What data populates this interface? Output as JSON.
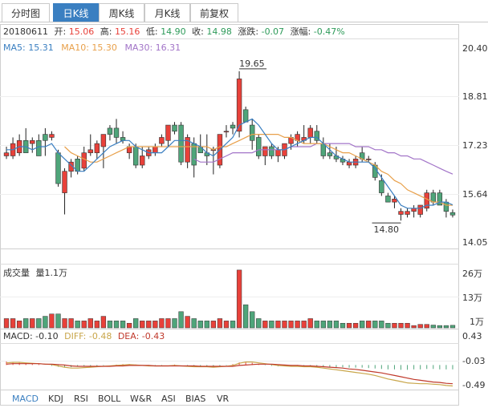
{
  "tabs": [
    {
      "label": "分时图",
      "active": false
    },
    {
      "label": "日K线",
      "active": true
    },
    {
      "label": "周K线",
      "active": false
    },
    {
      "label": "月K线",
      "active": false
    },
    {
      "label": "前复权",
      "active": false
    }
  ],
  "info_bar": {
    "date": "20180611",
    "open_label": "开:",
    "open": "15.06",
    "high_label": "高:",
    "high": "15.16",
    "low_label": "低:",
    "low": "14.90",
    "close_label": "收:",
    "close": "14.98",
    "change_label": "涨跌:",
    "change": "-0.07",
    "pct_label": "涨幅:",
    "pct": "-0.47%"
  },
  "ma_bar": {
    "ma5": "MA5: 15.31",
    "ma10": "MA10: 15.30",
    "ma30": "MA30: 16.31"
  },
  "volume_bar": {
    "title": "成交量",
    "value": "量1.1万"
  },
  "macd_bar": {
    "macd": "MACD: -0.10",
    "diff": "DIFF: -0.48",
    "dea": "DEA: -0.43"
  },
  "indicator_tabs": [
    {
      "label": "MACD",
      "active": true
    },
    {
      "label": "KDJ",
      "active": false
    },
    {
      "label": "RSI",
      "active": false
    },
    {
      "label": "BOLL",
      "active": false
    },
    {
      "label": "W&R",
      "active": false
    },
    {
      "label": "ASI",
      "active": false
    },
    {
      "label": "BIAS",
      "active": false
    },
    {
      "label": "VR",
      "active": false
    }
  ],
  "colors": {
    "up": "#e8413a",
    "down": "#4fa57a",
    "ma5": "#3a7fc1",
    "ma10": "#e8a04a",
    "ma30": "#a274c8",
    "diff": "#c9a64a",
    "dea": "#c0392b",
    "tab_active": "#3a7fc1",
    "grid": "#dcdcdc",
    "down_text": "#2e9b5a"
  },
  "chart_data": [
    {
      "type": "candlestick",
      "title": "",
      "ylim": [
        14.05,
        20.4
      ],
      "y_ticks": [
        "20.40",
        "18.81",
        "17.23",
        "15.64",
        "14.05"
      ],
      "annotations": [
        {
          "label": "19.65",
          "kind": "high"
        },
        {
          "label": "14.80",
          "kind": "low"
        }
      ],
      "candles": [
        [
          16.9,
          17.2,
          16.8,
          17.0
        ],
        [
          16.9,
          17.5,
          16.8,
          17.3
        ],
        [
          17.0,
          17.6,
          16.9,
          17.4
        ],
        [
          17.4,
          17.8,
          17.0,
          17.0
        ],
        [
          17.3,
          17.5,
          17.0,
          17.4
        ],
        [
          17.4,
          17.6,
          16.9,
          16.9
        ],
        [
          17.6,
          17.8,
          16.9,
          17.4
        ],
        [
          17.5,
          17.7,
          17.4,
          17.6
        ],
        [
          17.0,
          17.1,
          15.9,
          16.0
        ],
        [
          15.7,
          16.5,
          15.0,
          16.4
        ],
        [
          16.4,
          16.8,
          16.2,
          16.7
        ],
        [
          16.8,
          16.9,
          16.3,
          16.4
        ],
        [
          16.5,
          17.2,
          16.4,
          17.0
        ],
        [
          17.0,
          17.6,
          16.9,
          17.1
        ],
        [
          17.0,
          17.4,
          16.8,
          17.3
        ],
        [
          17.2,
          17.6,
          16.5,
          17.6
        ],
        [
          17.8,
          17.9,
          17.4,
          17.6
        ],
        [
          17.8,
          18.1,
          17.3,
          17.5
        ],
        [
          17.5,
          17.7,
          17.3,
          17.4
        ],
        [
          17.0,
          17.3,
          16.8,
          17.2
        ],
        [
          17.2,
          17.3,
          16.5,
          16.6
        ],
        [
          16.6,
          17.2,
          16.5,
          16.9
        ],
        [
          16.9,
          17.2,
          16.8,
          17.1
        ],
        [
          17.0,
          17.3,
          16.9,
          17.2
        ],
        [
          17.3,
          17.6,
          17.2,
          17.5
        ],
        [
          17.4,
          17.9,
          17.2,
          17.9
        ],
        [
          17.9,
          18.0,
          17.6,
          17.7
        ],
        [
          17.9,
          18.0,
          16.6,
          16.7
        ],
        [
          16.7,
          17.6,
          16.5,
          17.5
        ],
        [
          17.3,
          17.5,
          16.2,
          16.6
        ],
        [
          17.2,
          17.6,
          17.0,
          17.0
        ],
        [
          17.0,
          17.6,
          16.6,
          16.9
        ],
        [
          17.1,
          17.2,
          16.3,
          17.1
        ],
        [
          16.6,
          17.6,
          16.5,
          17.6
        ],
        [
          17.7,
          17.9,
          17.5,
          17.7
        ],
        [
          17.9,
          18.0,
          17.6,
          17.8
        ],
        [
          17.7,
          19.65,
          17.5,
          19.4
        ],
        [
          18.4,
          18.5,
          18.0,
          18.0
        ],
        [
          17.9,
          18.1,
          17.1,
          17.4
        ],
        [
          17.5,
          17.6,
          16.8,
          16.9
        ],
        [
          16.9,
          17.2,
          16.6,
          17.2
        ],
        [
          17.2,
          17.3,
          16.8,
          16.9
        ],
        [
          16.9,
          17.2,
          16.7,
          17.1
        ],
        [
          16.9,
          17.3,
          16.8,
          17.3
        ],
        [
          17.3,
          17.6,
          17.1,
          17.5
        ],
        [
          17.4,
          17.7,
          17.2,
          17.6
        ],
        [
          17.4,
          17.9,
          17.3,
          17.5
        ],
        [
          17.5,
          17.9,
          17.3,
          17.8
        ],
        [
          17.7,
          17.9,
          17.3,
          17.4
        ],
        [
          17.3,
          17.5,
          16.8,
          16.9
        ],
        [
          17.0,
          17.3,
          16.8,
          16.9
        ],
        [
          16.9,
          17.2,
          16.7,
          16.8
        ],
        [
          16.8,
          16.9,
          16.6,
          16.7
        ],
        [
          16.6,
          16.8,
          16.5,
          16.7
        ],
        [
          16.6,
          16.9,
          16.5,
          16.8
        ],
        [
          17.0,
          17.2,
          16.7,
          16.8
        ],
        [
          16.8,
          16.9,
          16.7,
          16.8
        ],
        [
          16.6,
          16.7,
          16.1,
          16.2
        ],
        [
          16.1,
          16.3,
          15.6,
          15.7
        ],
        [
          15.6,
          15.7,
          15.4,
          15.4
        ],
        [
          15.4,
          15.6,
          15.2,
          15.5
        ],
        [
          15.0,
          15.2,
          14.8,
          15.1
        ],
        [
          15.0,
          15.2,
          14.9,
          15.1
        ],
        [
          15.1,
          15.3,
          14.9,
          15.2
        ],
        [
          15.0,
          15.3,
          14.9,
          15.3
        ],
        [
          15.2,
          15.8,
          15.1,
          15.7
        ],
        [
          15.7,
          15.8,
          15.3,
          15.4
        ],
        [
          15.7,
          15.8,
          15.3,
          15.3
        ],
        [
          15.4,
          15.5,
          14.9,
          15.1
        ],
        [
          15.06,
          15.16,
          14.9,
          14.98
        ]
      ],
      "ma5": [
        17.1,
        17.1,
        17.2,
        17.2,
        17.1,
        17.2,
        17.2,
        17.3,
        17.0,
        16.8,
        16.6,
        16.4,
        16.4,
        16.6,
        16.8,
        17.0,
        17.2,
        17.3,
        17.4,
        17.4,
        17.2,
        17.1,
        17.0,
        17.0,
        17.0,
        17.2,
        17.4,
        17.4,
        17.4,
        17.3,
        17.2,
        17.0,
        16.9,
        17.1,
        17.3,
        17.5,
        17.9,
        18.0,
        18.1,
        17.9,
        17.6,
        17.3,
        17.1,
        17.1,
        17.2,
        17.3,
        17.4,
        17.5,
        17.5,
        17.3,
        17.1,
        16.9,
        16.8,
        16.7,
        16.7,
        16.7,
        16.7,
        16.5,
        16.2,
        15.9,
        15.6,
        15.3,
        15.2,
        15.2,
        15.2,
        15.3,
        15.3,
        15.4,
        15.4,
        15.31
      ],
      "ma10": [
        null,
        null,
        null,
        null,
        null,
        null,
        null,
        null,
        null,
        17.2,
        17.0,
        16.9,
        16.8,
        16.7,
        16.7,
        16.8,
        16.9,
        17.0,
        17.1,
        17.2,
        17.2,
        17.2,
        17.2,
        17.2,
        17.2,
        17.2,
        17.2,
        17.2,
        17.2,
        17.2,
        17.2,
        17.2,
        17.1,
        17.2,
        17.2,
        17.3,
        17.4,
        17.5,
        17.6,
        17.6,
        17.6,
        17.6,
        17.6,
        17.5,
        17.5,
        17.4,
        17.3,
        17.3,
        17.3,
        17.3,
        17.2,
        17.1,
        17.0,
        17.0,
        16.9,
        16.8,
        16.7,
        16.6,
        16.4,
        16.3,
        16.1,
        16.0,
        15.8,
        15.7,
        15.6,
        15.5,
        15.4,
        15.4,
        15.3,
        15.3
      ],
      "ma30": [
        null,
        null,
        null,
        null,
        null,
        null,
        null,
        null,
        null,
        null,
        null,
        null,
        null,
        null,
        null,
        null,
        null,
        null,
        null,
        null,
        null,
        null,
        null,
        null,
        null,
        null,
        null,
        null,
        null,
        16.8,
        16.7,
        16.7,
        16.7,
        16.8,
        16.9,
        17.0,
        17.0,
        17.0,
        17.0,
        17.1,
        17.1,
        17.1,
        17.1,
        17.1,
        17.2,
        17.2,
        17.2,
        17.2,
        17.3,
        17.3,
        17.3,
        17.3,
        17.3,
        17.3,
        17.2,
        17.2,
        17.2,
        17.1,
        17.1,
        17.0,
        17.0,
        16.9,
        16.9,
        16.8,
        16.8,
        16.7,
        16.6,
        16.5,
        16.4,
        16.31
      ]
    },
    {
      "type": "bar",
      "title": "成交量",
      "ylim": [
        0,
        26
      ],
      "y_ticks": [
        "26万",
        "13万",
        "1万"
      ],
      "values": [
        4,
        4,
        3,
        4,
        4,
        4,
        5,
        6,
        6,
        4,
        4,
        3,
        3,
        4,
        3,
        5,
        3,
        3,
        3,
        2,
        4,
        3,
        3,
        3,
        4,
        4,
        4,
        7,
        5,
        4,
        3,
        3,
        3,
        4,
        3,
        3,
        25,
        10,
        7,
        4,
        3,
        3,
        3,
        3,
        3,
        3,
        3,
        4,
        3,
        3,
        3,
        3,
        2,
        2,
        2,
        3,
        3,
        3,
        3,
        2,
        2,
        2,
        2,
        1,
        1.5,
        1.5,
        1.2,
        1,
        1,
        1.1
      ]
    },
    {
      "type": "bar",
      "title": "MACD",
      "ylim": [
        -0.49,
        0.43
      ],
      "y_ticks": [
        "0.43",
        "-0.03",
        "-0.49"
      ],
      "macd": [
        0.08,
        0.07,
        0.06,
        0.05,
        0.04,
        0.02,
        0.0,
        -0.02,
        -0.04,
        -0.06,
        -0.05,
        -0.04,
        -0.03,
        -0.02,
        -0.02,
        -0.01,
        0.0,
        0.01,
        0.02,
        0.02,
        0.01,
        0.0,
        -0.01,
        -0.01,
        -0.01,
        0.0,
        0.01,
        0.0,
        -0.02,
        -0.03,
        -0.02,
        -0.02,
        -0.03,
        -0.02,
        -0.01,
        0.02,
        0.06,
        0.07,
        0.05,
        0.02,
        -0.01,
        -0.02,
        -0.03,
        -0.02,
        -0.02,
        -0.01,
        -0.01,
        -0.01,
        -0.02,
        -0.03,
        -0.04,
        -0.05,
        -0.05,
        -0.06,
        -0.06,
        -0.06,
        -0.07,
        -0.08,
        -0.09,
        -0.1,
        -0.1,
        -0.11,
        -0.11,
        -0.1,
        -0.1,
        -0.09,
        -0.09,
        -0.1,
        -0.1,
        -0.1
      ],
      "diff": [
        0.05,
        0.06,
        0.06,
        0.05,
        0.04,
        0.03,
        0.02,
        0.01,
        -0.02,
        -0.05,
        -0.07,
        -0.07,
        -0.06,
        -0.05,
        -0.04,
        -0.03,
        -0.02,
        -0.01,
        0.0,
        0.01,
        0.0,
        -0.01,
        -0.02,
        -0.02,
        -0.02,
        -0.02,
        -0.01,
        -0.02,
        -0.03,
        -0.04,
        -0.04,
        -0.04,
        -0.05,
        -0.04,
        -0.03,
        -0.01,
        0.04,
        0.07,
        0.07,
        0.05,
        0.03,
        0.01,
        -0.01,
        -0.02,
        -0.03,
        -0.03,
        -0.04,
        -0.04,
        -0.05,
        -0.07,
        -0.09,
        -0.11,
        -0.13,
        -0.15,
        -0.17,
        -0.19,
        -0.21,
        -0.24,
        -0.28,
        -0.32,
        -0.35,
        -0.38,
        -0.41,
        -0.42,
        -0.43,
        -0.43,
        -0.44,
        -0.45,
        -0.47,
        -0.48
      ],
      "dea": [
        0.02,
        0.03,
        0.03,
        0.03,
        0.03,
        0.03,
        0.02,
        0.02,
        0.01,
        0.0,
        -0.02,
        -0.03,
        -0.03,
        -0.03,
        -0.03,
        -0.03,
        -0.03,
        -0.02,
        -0.02,
        -0.01,
        -0.01,
        -0.01,
        -0.01,
        -0.02,
        -0.02,
        -0.02,
        -0.02,
        -0.02,
        -0.02,
        -0.02,
        -0.03,
        -0.03,
        -0.03,
        -0.03,
        -0.03,
        -0.03,
        -0.01,
        0.0,
        0.01,
        0.02,
        0.02,
        0.02,
        0.01,
        0.0,
        -0.01,
        -0.01,
        -0.02,
        -0.02,
        -0.03,
        -0.04,
        -0.05,
        -0.06,
        -0.07,
        -0.09,
        -0.1,
        -0.12,
        -0.14,
        -0.16,
        -0.18,
        -0.21,
        -0.24,
        -0.27,
        -0.3,
        -0.33,
        -0.35,
        -0.37,
        -0.39,
        -0.4,
        -0.42,
        -0.43
      ]
    }
  ]
}
